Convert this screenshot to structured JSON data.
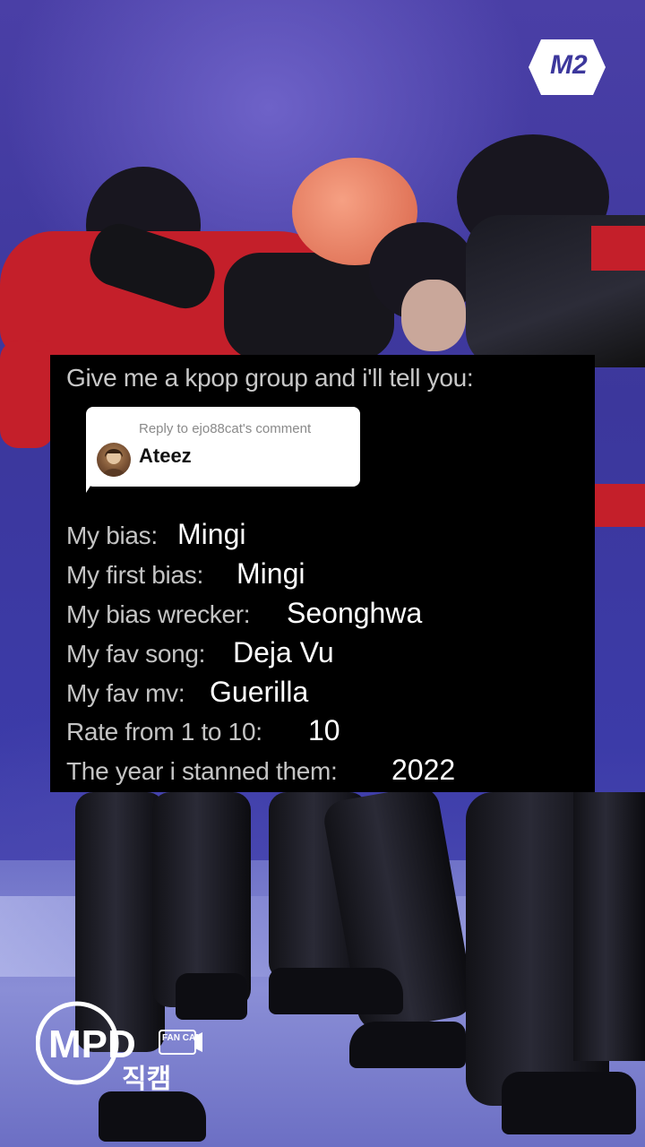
{
  "card": {
    "prompt": "Give me a kpop group and i'll tell you:",
    "reply": {
      "header": "Reply to ejo88cat's comment",
      "text": "Ateez"
    },
    "rows": [
      {
        "label": "My bias:",
        "value": "Mingi"
      },
      {
        "label": "My first bias:",
        "value": "Mingi"
      },
      {
        "label": "My bias wrecker:",
        "value": "Seonghwa"
      },
      {
        "label": "My fav song:",
        "value": "Deja Vu"
      },
      {
        "label": "My fav mv:",
        "value": "Guerilla"
      },
      {
        "label": "Rate from 1 to 10:",
        "value": "10"
      },
      {
        "label": "The year i stanned them:",
        "value": "2022"
      }
    ]
  },
  "logos": {
    "top_right": "M2",
    "bottom_left_main": "MPD",
    "bottom_left_tag": "FAN CAM",
    "bottom_left_korean": "직캠"
  },
  "colors": {
    "stage": "#3c379c",
    "card_bg": "#000000",
    "jacket": "#c41f2a"
  }
}
